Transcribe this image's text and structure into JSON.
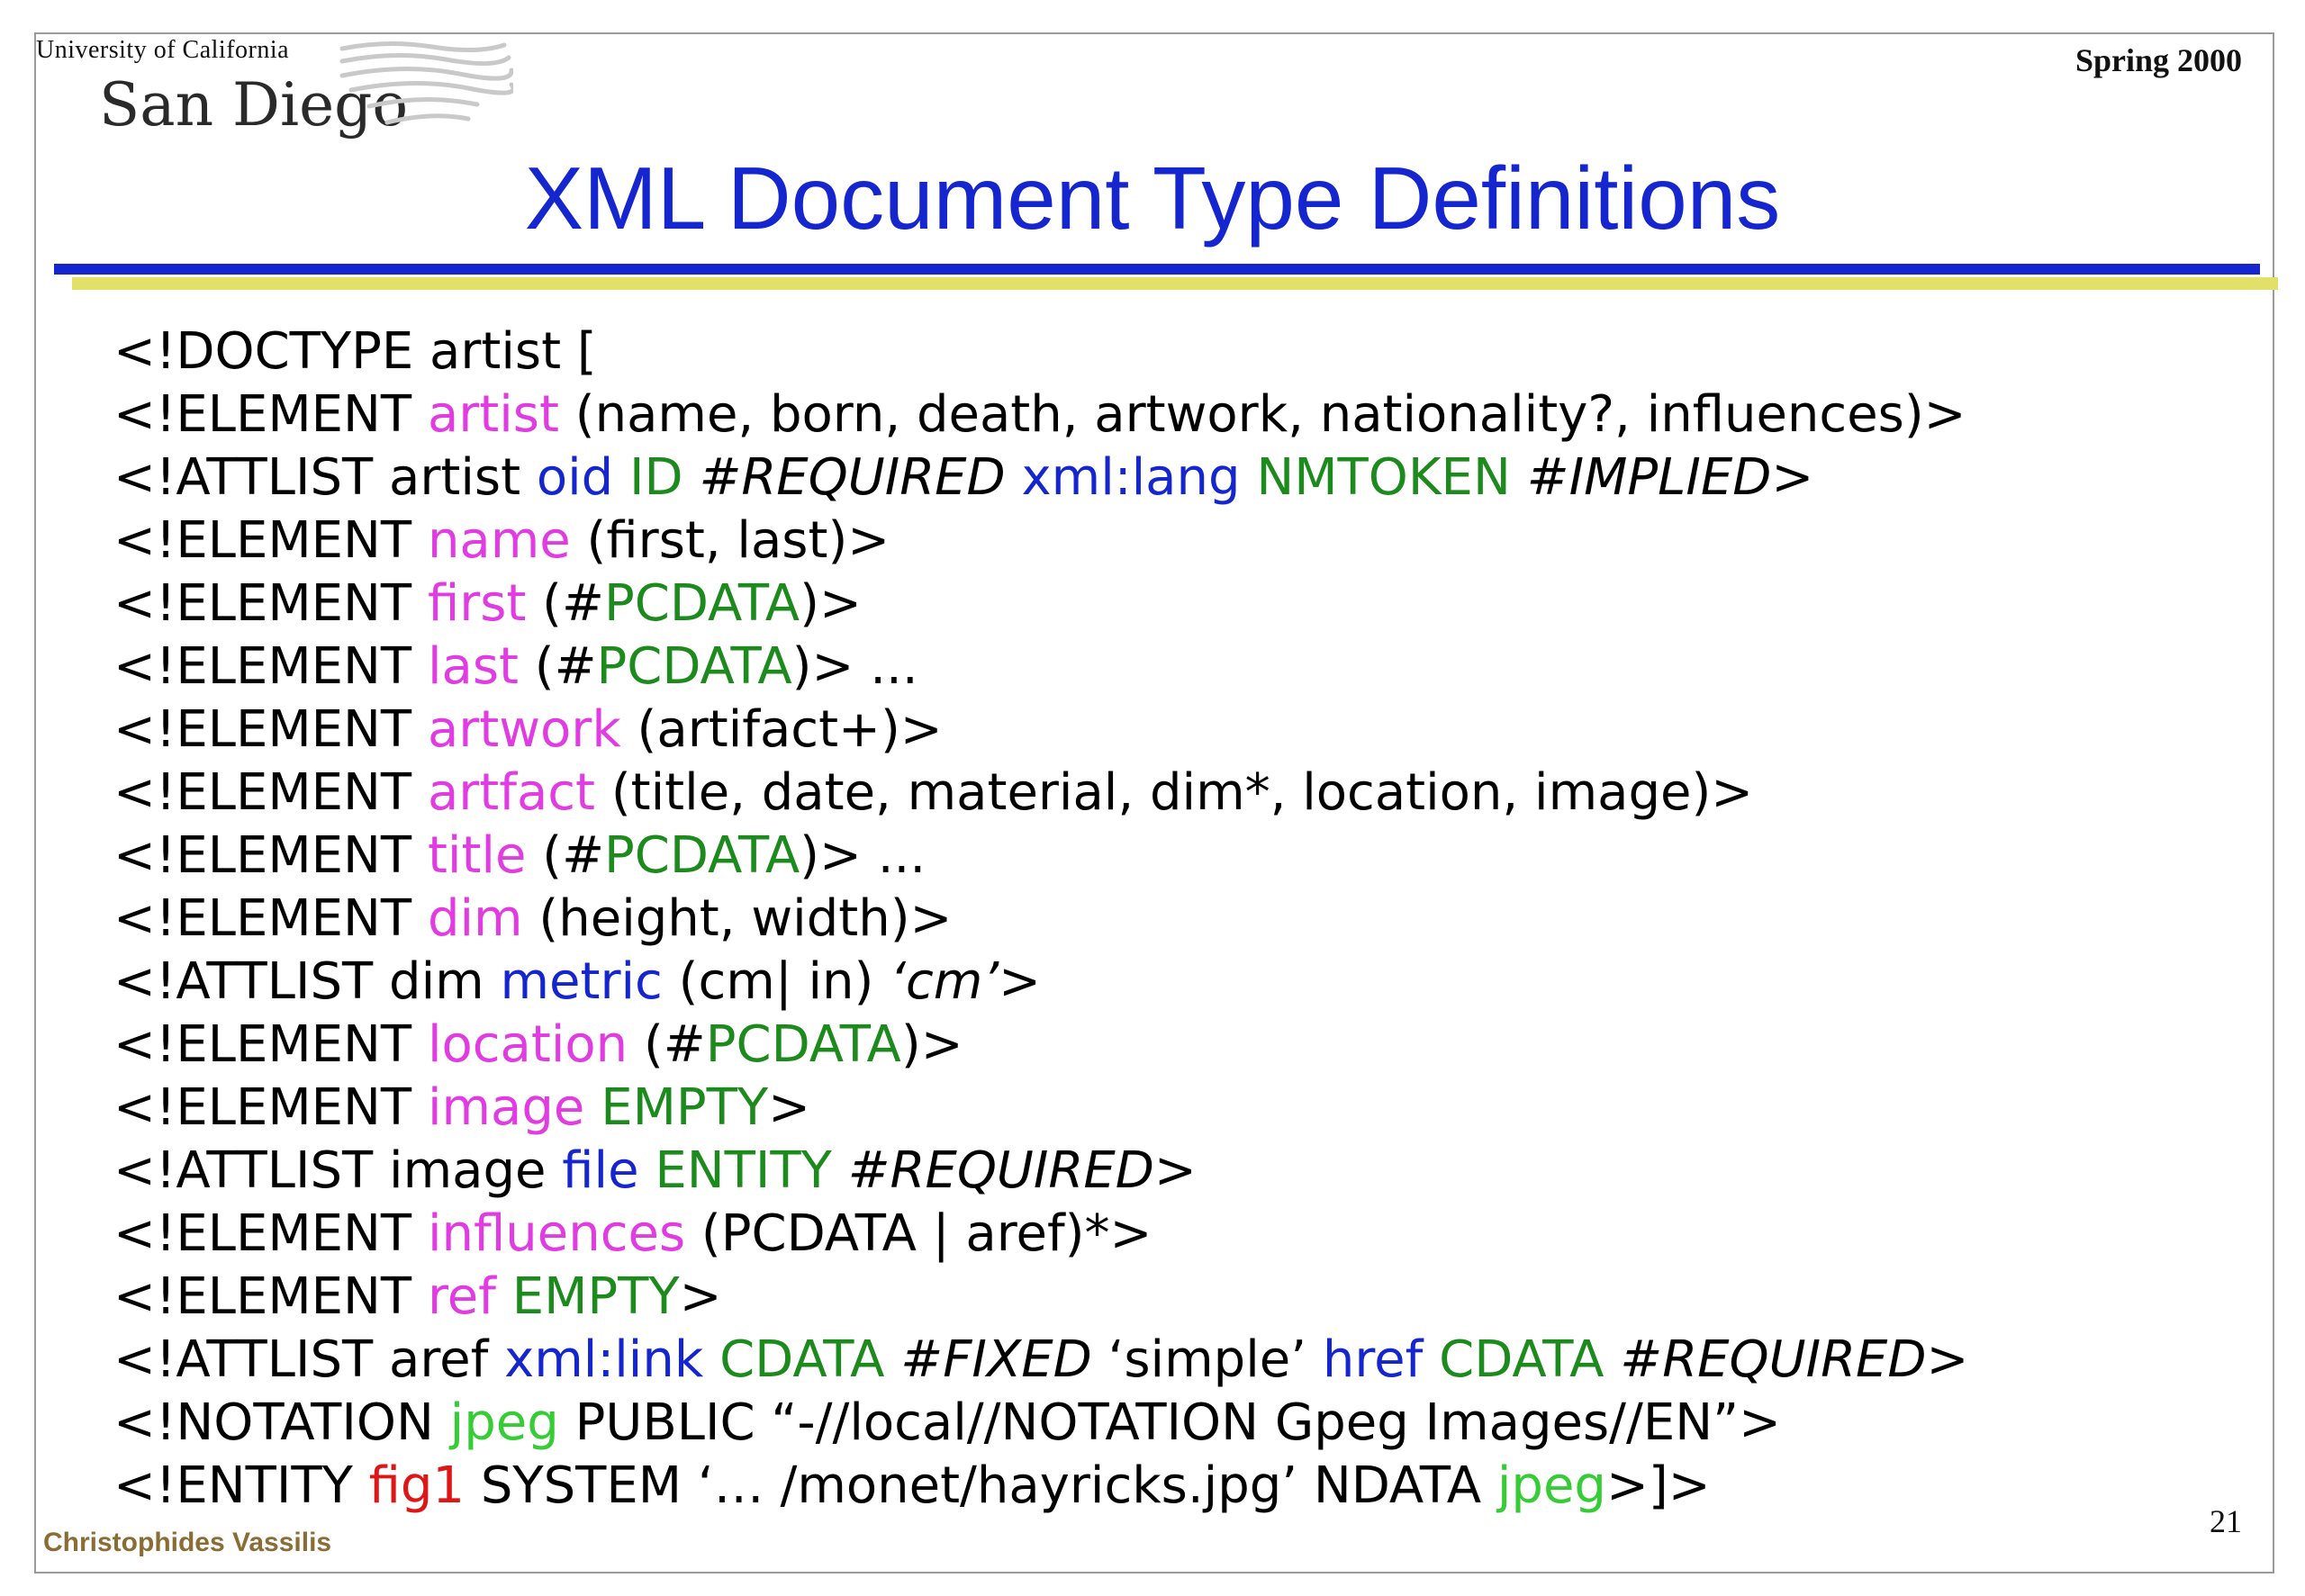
{
  "header": {
    "logo_university": "University of California",
    "logo_campus": "San Diego",
    "term": "Spring 2000"
  },
  "slide": {
    "title": "XML Document Type Definitions"
  },
  "colors": {
    "title": "#1626cf",
    "element_name": "#e13ce1",
    "datatype_keyword": "#1c8a1c",
    "attribute_name": "#1626cf",
    "notation_ref": "#35cc35",
    "entity_name": "#dd1717",
    "author": "#8a6d34",
    "rule_primary": "#1626cf",
    "rule_shadow": "#e3e06a"
  },
  "dtd_lines": [
    [
      {
        "t": "<!DOCTYPE artist ["
      }
    ],
    [
      {
        "t": "<!ELEMENT "
      },
      {
        "t": "artist",
        "c": "pink"
      },
      {
        "t": " (name, born, death, artwork, nationality?, influences)>"
      }
    ],
    [
      {
        "t": "<!ATTLIST artist "
      },
      {
        "t": "oid",
        "c": "blue"
      },
      {
        "t": " "
      },
      {
        "t": "ID",
        "c": "green"
      },
      {
        "t": " "
      },
      {
        "t": "#REQUIRED",
        "i": true
      },
      {
        "t": " "
      },
      {
        "t": "xml:lang",
        "c": "blue"
      },
      {
        "t": " "
      },
      {
        "t": "NMTOKEN",
        "c": "green"
      },
      {
        "t": " "
      },
      {
        "t": "#IMPLIED",
        "i": true
      },
      {
        "t": ">"
      }
    ],
    [
      {
        "t": "<!ELEMENT "
      },
      {
        "t": "name",
        "c": "pink"
      },
      {
        "t": " (first, last)>"
      }
    ],
    [
      {
        "t": "<!ELEMENT "
      },
      {
        "t": "first",
        "c": "pink"
      },
      {
        "t": " (#"
      },
      {
        "t": "PCDATA",
        "c": "green"
      },
      {
        "t": ")>"
      }
    ],
    [
      {
        "t": "<!ELEMENT "
      },
      {
        "t": "last",
        "c": "pink"
      },
      {
        "t": " (#"
      },
      {
        "t": "PCDATA",
        "c": "green"
      },
      {
        "t": ")> ..."
      }
    ],
    [
      {
        "t": "<!ELEMENT "
      },
      {
        "t": "artwork",
        "c": "pink"
      },
      {
        "t": " (artifact+)>"
      }
    ],
    [
      {
        "t": "<!ELEMENT "
      },
      {
        "t": "artfact",
        "c": "pink"
      },
      {
        "t": " (title, date, material, dim*, location, image)>"
      }
    ],
    [
      {
        "t": "<!ELEMENT "
      },
      {
        "t": "title",
        "c": "pink"
      },
      {
        "t": " (#"
      },
      {
        "t": "PCDATA",
        "c": "green"
      },
      {
        "t": ")> ..."
      }
    ],
    [
      {
        "t": "<!ELEMENT "
      },
      {
        "t": "dim",
        "c": "pink"
      },
      {
        "t": " (height, width)>"
      }
    ],
    [
      {
        "t": "<!ATTLIST dim "
      },
      {
        "t": "metric",
        "c": "blue"
      },
      {
        "t": " (cm| in) "
      },
      {
        "t": "‘cm’",
        "i": true
      },
      {
        "t": ">"
      }
    ],
    [
      {
        "t": "<!ELEMENT "
      },
      {
        "t": "location",
        "c": "pink"
      },
      {
        "t": " (#"
      },
      {
        "t": "PCDATA",
        "c": "green"
      },
      {
        "t": ")>"
      }
    ],
    [
      {
        "t": "<!ELEMENT "
      },
      {
        "t": "image",
        "c": "pink"
      },
      {
        "t": " "
      },
      {
        "t": "EMPTY",
        "c": "green"
      },
      {
        "t": ">"
      }
    ],
    [
      {
        "t": "<!ATTLIST image "
      },
      {
        "t": "file",
        "c": "blue"
      },
      {
        "t": " "
      },
      {
        "t": "ENTITY",
        "c": "green"
      },
      {
        "t": " "
      },
      {
        "t": "#REQUIRED",
        "i": true
      },
      {
        "t": ">"
      }
    ],
    [
      {
        "t": "<!ELEMENT "
      },
      {
        "t": "influences",
        "c": "pink"
      },
      {
        "t": " (PCDATA | aref)*>"
      }
    ],
    [
      {
        "t": "<!ELEMENT "
      },
      {
        "t": "ref",
        "c": "pink"
      },
      {
        "t": " "
      },
      {
        "t": "EMPTY",
        "c": "green"
      },
      {
        "t": ">"
      }
    ],
    [
      {
        "t": "<!ATTLIST aref "
      },
      {
        "t": "xml:link",
        "c": "blue"
      },
      {
        "t": " "
      },
      {
        "t": "CDATA",
        "c": "green"
      },
      {
        "t": " "
      },
      {
        "t": "#FIXED",
        "i": true
      },
      {
        "t": " ‘simple’ "
      },
      {
        "t": "href",
        "c": "blue"
      },
      {
        "t": " "
      },
      {
        "t": "CDATA",
        "c": "green"
      },
      {
        "t": " "
      },
      {
        "t": "#REQUIRED",
        "i": true
      },
      {
        "t": ">"
      }
    ],
    [
      {
        "t": "<!NOTATION "
      },
      {
        "t": "jpeg",
        "c": "lime"
      },
      {
        "t": " PUBLIC “-//local//NOTATION Gpeg Images//EN”>"
      }
    ],
    [
      {
        "t": "<!ENTITY "
      },
      {
        "t": "fig1",
        "c": "red"
      },
      {
        "t": " SYSTEM ‘… /monet/hayricks.jpg’ NDATA "
      },
      {
        "t": "jpeg",
        "c": "lime"
      },
      {
        "t": ">]>"
      }
    ]
  ],
  "footer": {
    "author": "Christophides Vassilis",
    "page_number": "21"
  }
}
